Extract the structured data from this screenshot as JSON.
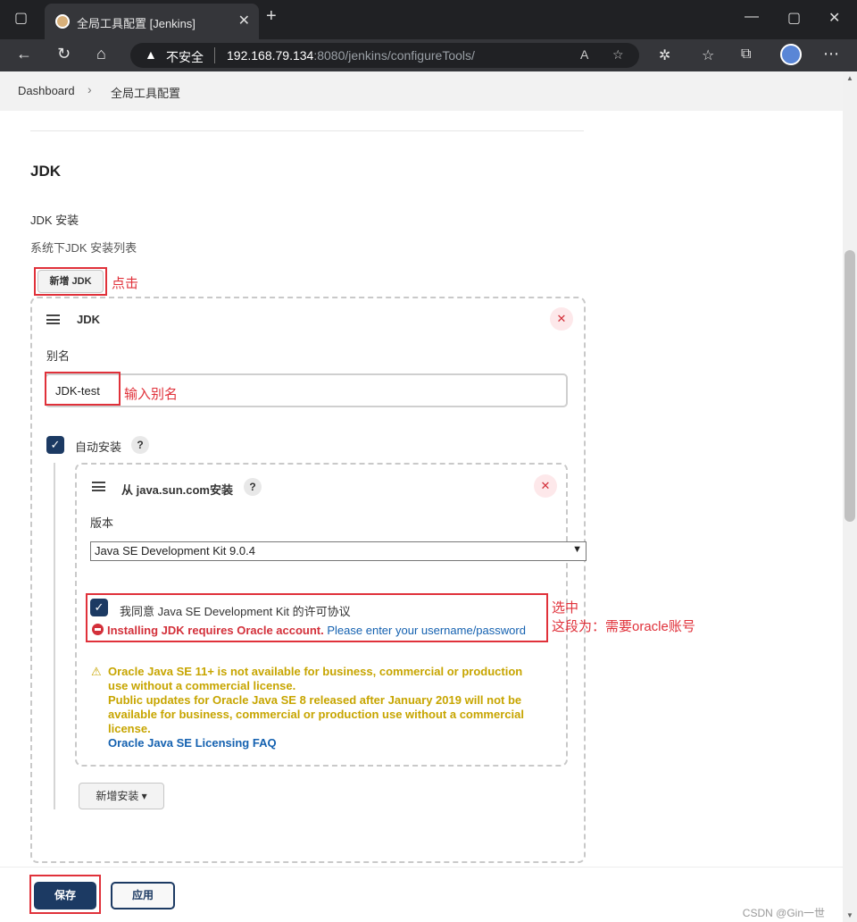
{
  "browser": {
    "tab_title": "全局工具配置 [Jenkins]",
    "security_label": "不安全",
    "url_host": "192.168.79.134",
    "url_rest": ":8080/jenkins/configureTools/"
  },
  "breadcrumb": {
    "items": [
      "Dashboard",
      "全局工具配置"
    ]
  },
  "jdk_section": {
    "title": "JDK",
    "install_label": "JDK 安装",
    "install_desc": "系统下JDK 安装列表",
    "add_button": "新增 JDK",
    "entry": {
      "header": "JDK",
      "alias_label": "别名",
      "alias_value": "JDK-test",
      "auto_install_label": "自动安装",
      "help": "?",
      "installer": {
        "header": "从 java.sun.com安装",
        "version_label": "版本",
        "version_value": "Java SE Development Kit 9.0.4",
        "license_label": "我同意 Java SE Development Kit 的许可协议",
        "error_text": "Installing JDK requires Oracle account.",
        "error_link": "Please enter your username/password",
        "warning_lines": [
          "Oracle Java SE 11+ is not available for business, commercial or production",
          "use without a commercial license.",
          "Public updates for Oracle Java SE 8 released after January 2019 will not be",
          "available for business, commercial or production use without a commercial",
          "license."
        ],
        "warning_link": "Oracle Java SE Licensing FAQ"
      },
      "add_installer_button": "新增安装 ▾"
    }
  },
  "annotations": {
    "click": "点击",
    "enter_alias": "输入别名",
    "select_line1": "选中",
    "select_line2": "这段为：需要oracle账号"
  },
  "footer": {
    "save": "保存",
    "apply": "应用"
  },
  "watermark": "CSDN @Gin一世",
  "colors": {
    "primary": "#1c3a63",
    "error": "#d3303a",
    "warning": "#c7a500",
    "link": "#1461b0",
    "annotation": "#e0313a"
  }
}
